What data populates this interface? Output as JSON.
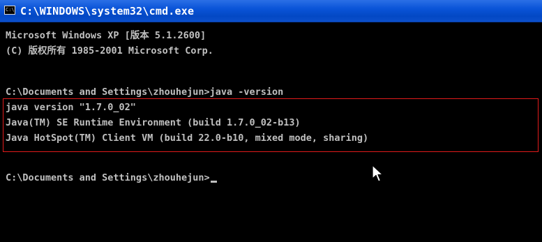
{
  "window": {
    "title": "C:\\WINDOWS\\system32\\cmd.exe",
    "icon_label": "C:\\"
  },
  "console": {
    "lines": [
      "Microsoft Windows XP [版本 5.1.2600]",
      "(C) 版权所有 1985-2001 Microsoft Corp.",
      "",
      "C:\\Documents and Settings\\zhouhejun>java -version",
      "java version \"1.7.0_02\"",
      "Java(TM) SE Runtime Environment (build 1.7.0_02-b13)",
      "Java HotSpot(TM) Client VM (build 22.0-b10, mixed mode, sharing)",
      "",
      "C:\\Documents and Settings\\zhouhejun>"
    ]
  },
  "colors": {
    "console_bg": "#000000",
    "console_text": "#c0c0c0",
    "titlebar": "#0a54d8",
    "highlight_border": "#e21b1b"
  },
  "icons": [
    "cmd-app-icon",
    "mouse-pointer-icon"
  ]
}
